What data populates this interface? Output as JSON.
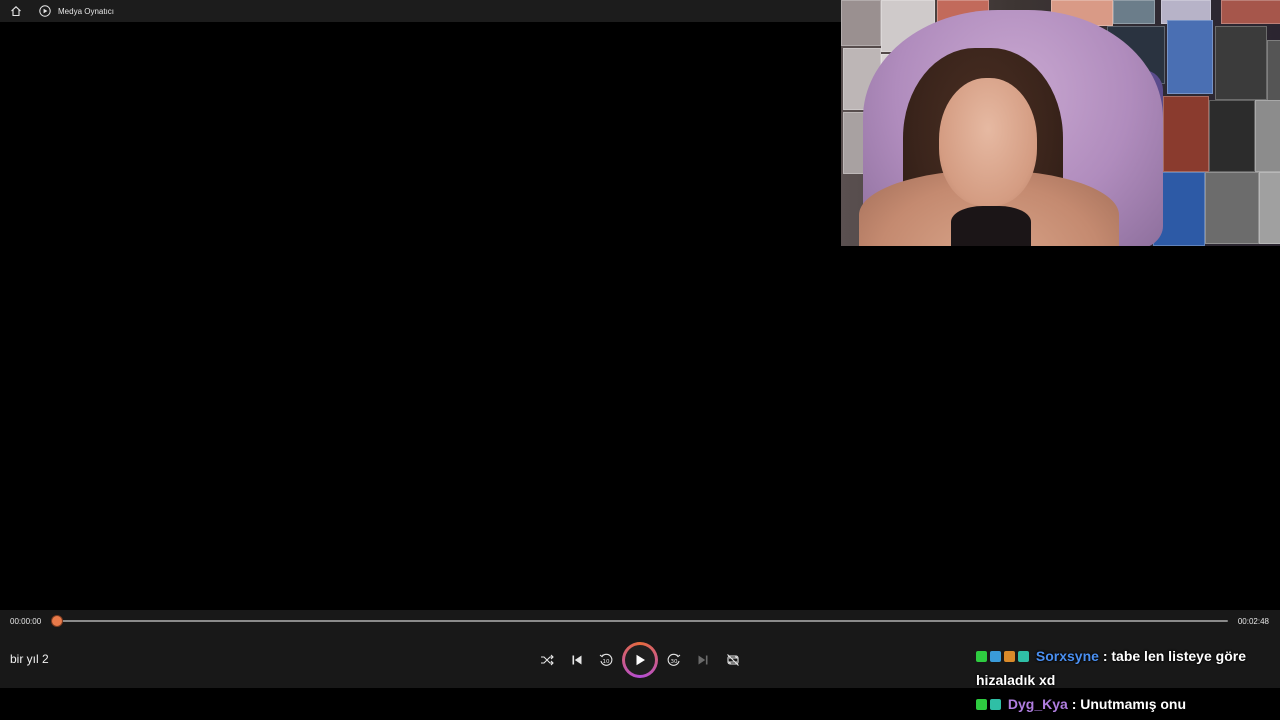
{
  "titlebar": {
    "home_icon": "home-icon",
    "app_icon": "media-player-icon",
    "title": "Medya Oynatıcı"
  },
  "player": {
    "current_time": "00:00:00",
    "total_time": "00:02:48",
    "progress": 0.0,
    "track_title": "bir yıl 2",
    "accent_color": "#e87a4a",
    "buttons": [
      {
        "name": "shuffle-button",
        "icon": "shuffle-icon"
      },
      {
        "name": "previous-button",
        "icon": "previous-icon"
      },
      {
        "name": "rewind-10-button",
        "icon": "rewind-10-icon"
      },
      {
        "name": "play-button",
        "icon": "play-icon"
      },
      {
        "name": "forward-30-button",
        "icon": "forward-30-icon"
      },
      {
        "name": "next-button",
        "icon": "next-icon"
      },
      {
        "name": "repeat-button",
        "icon": "repeat-off-icon"
      }
    ]
  },
  "chat": {
    "messages": [
      {
        "user": "Sorxsyne",
        "user_color": "#4a8ff0",
        "text": ": tabe len listeye göre hizaladık xd"
      },
      {
        "user": "Dyg_Kya",
        "user_color": "#b07ee0",
        "text": ": Unutmamış onu"
      }
    ]
  }
}
